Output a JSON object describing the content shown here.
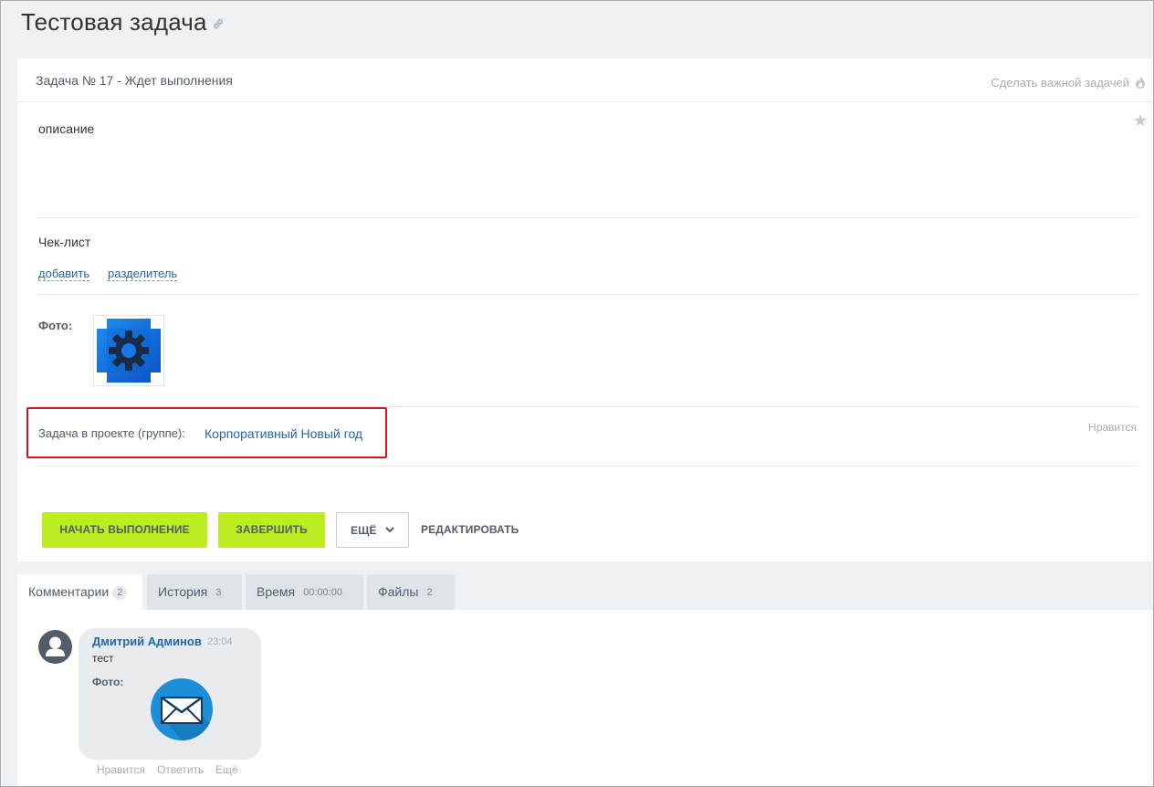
{
  "page": {
    "title": "Тестовая задача"
  },
  "task": {
    "status_line": "Задача № 17 - Ждет выполнения",
    "make_important": "Сделать важной задачей",
    "description": "описание",
    "checklist_title": "Чек-лист",
    "checklist_add": "добавить",
    "checklist_separator": "разделитель",
    "photo_label": "Фото:",
    "project_label": "Задача в проекте (группе):",
    "project_name": "Корпоративный Новый год",
    "likes_label": "Нравится"
  },
  "actions": {
    "start": "Начать выполнение",
    "finish": "Завершить",
    "more": "Ещё",
    "edit": "Редактировать"
  },
  "tabs": [
    {
      "label": "Комментарии",
      "badge": "2",
      "active": true
    },
    {
      "label": "История",
      "badge": "3",
      "active": false
    },
    {
      "label": "Время",
      "badge": "00:00:00",
      "active": false
    },
    {
      "label": "Файлы",
      "badge": "2",
      "active": false
    }
  ],
  "comment": {
    "author": "Дмитрий Админов",
    "time": "23:04",
    "text": "тест",
    "photo_label": "Фото:",
    "like": "Нравится",
    "reply": "Ответить",
    "more": "Ещё"
  },
  "colors": {
    "accent_green": "#bbed21",
    "link_blue": "#2067b0",
    "highlight_red": "#d4151b"
  },
  "icons": {
    "title_link": "link-icon",
    "important": "flame-icon",
    "favorite": "star-icon",
    "more_dropdown": "chevron-down-icon",
    "avatar": "user-avatar-icon"
  }
}
